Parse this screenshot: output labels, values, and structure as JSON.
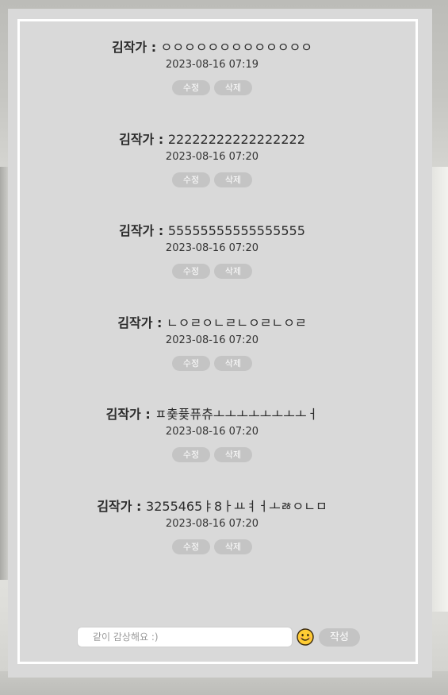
{
  "comments": [
    {
      "author": "김작가",
      "separator": " : ",
      "content": "ㅇㅇㅇㅇㅇㅇㅇㅇㅇㅇㅇㅇㅇ",
      "date": "2023-08-16 07:19",
      "edit_label": "수정",
      "delete_label": "삭제"
    },
    {
      "author": "김작가",
      "separator": " : ",
      "content": "22222222222222222",
      "date": "2023-08-16 07:20",
      "edit_label": "수정",
      "delete_label": "삭제"
    },
    {
      "author": "김작가",
      "separator": " : ",
      "content": "55555555555555555",
      "date": "2023-08-16 07:20",
      "edit_label": "수정",
      "delete_label": "삭제"
    },
    {
      "author": "김작가",
      "separator": " : ",
      "content": "ㄴㅇㄹㅇㄴㄹㄴㅇㄹㄴㅇㄹ",
      "date": "2023-08-16 07:20",
      "edit_label": "수정",
      "delete_label": "삭제"
    },
    {
      "author": "김작가",
      "separator": " : ",
      "content": "ㅍ춏퓿퓨츄ㅗㅗㅗㅗㅗㅗㅗㅗㅓ",
      "date": "2023-08-16 07:20",
      "edit_label": "수정",
      "delete_label": "삭제"
    },
    {
      "author": "김작가",
      "separator": " : ",
      "content": "3255465ㅑ8ㅏㅛㅕㅓㅗㅀㅇㄴㅁ",
      "date": "2023-08-16 07:20",
      "edit_label": "수정",
      "delete_label": "삭제"
    }
  ],
  "composer": {
    "placeholder": "같이 감상해요 :)",
    "value": "",
    "emoji_icon": "smiley-face-icon",
    "submit_label": "작성"
  },
  "colors": {
    "panel_bg": "#d9d9d9",
    "button_bg": "#c4c4c4",
    "button_text": "#ffffff",
    "text": "#2b2b2b",
    "emoji_fill": "#ffcc33"
  }
}
